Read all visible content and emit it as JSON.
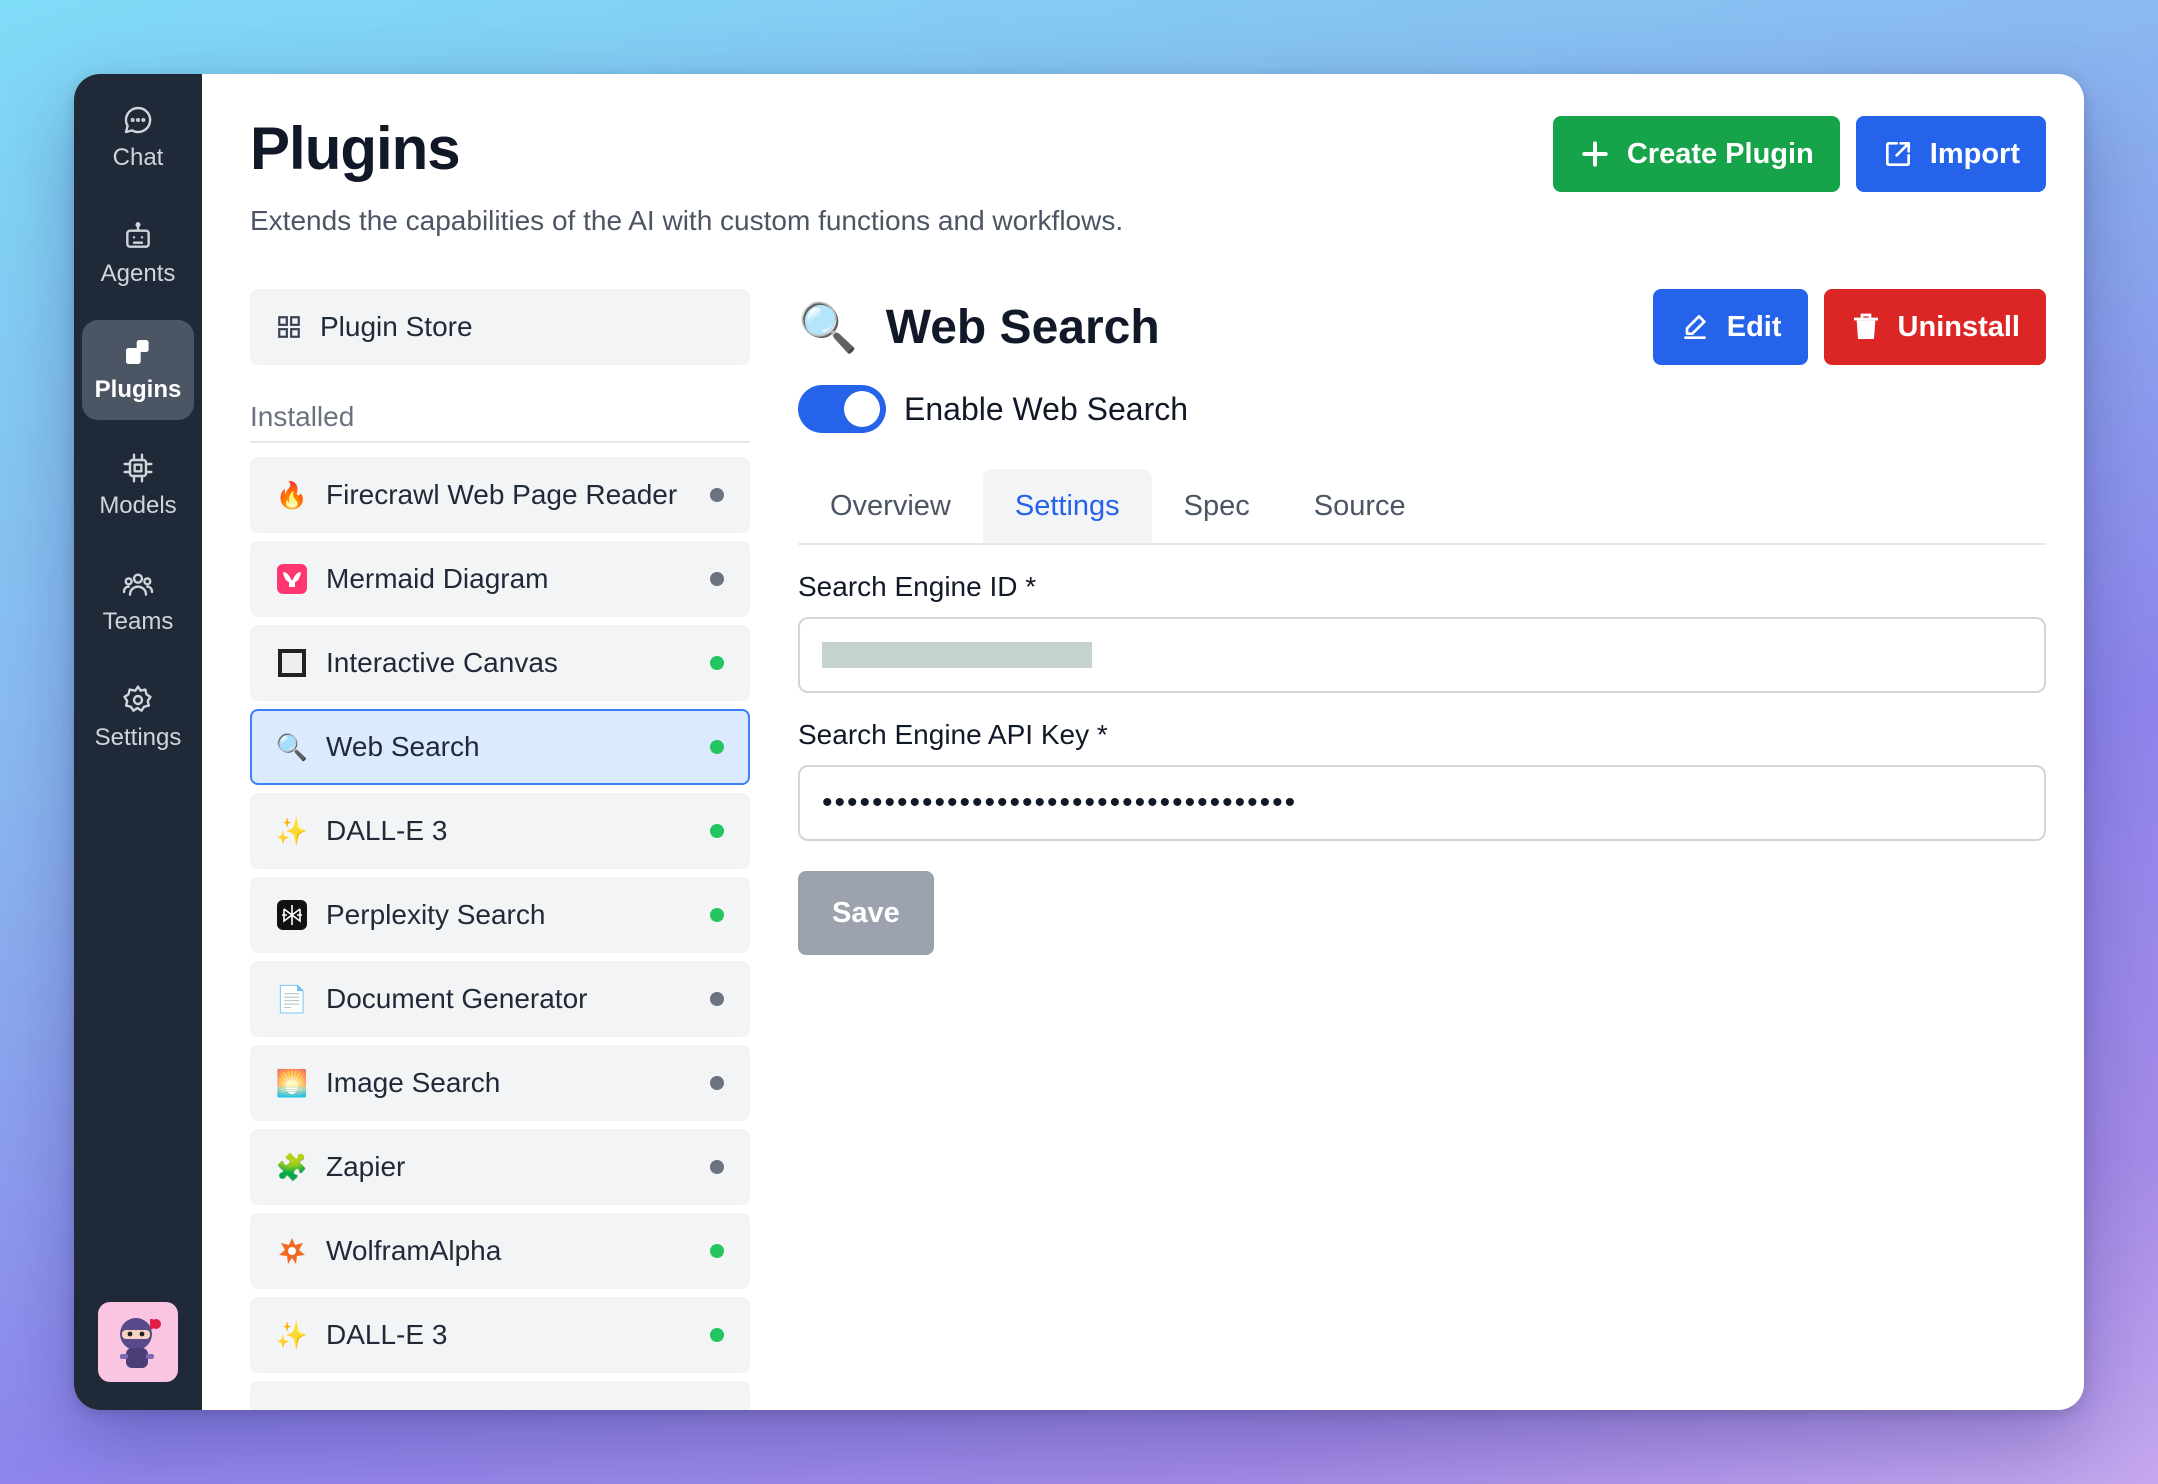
{
  "sidebar": {
    "items": [
      {
        "label": "Chat",
        "icon": "chat-icon"
      },
      {
        "label": "Agents",
        "icon": "agents-icon"
      },
      {
        "label": "Plugins",
        "icon": "plugins-icon",
        "active": true
      },
      {
        "label": "Models",
        "icon": "models-icon"
      },
      {
        "label": "Teams",
        "icon": "teams-icon"
      },
      {
        "label": "Settings",
        "icon": "settings-icon"
      }
    ]
  },
  "header": {
    "title": "Plugins",
    "subtitle": "Extends the capabilities of the AI with custom functions and workflows.",
    "create_label": "Create Plugin",
    "import_label": "Import"
  },
  "store": {
    "label": "Plugin Store"
  },
  "installed": {
    "label": "Installed",
    "items": [
      {
        "name": "Firecrawl Web Page Reader",
        "icon": "🔥",
        "enabled": false
      },
      {
        "name": "Mermaid Diagram",
        "icon": "mermaid",
        "enabled": false
      },
      {
        "name": "Interactive Canvas",
        "icon": "canvas",
        "enabled": true
      },
      {
        "name": "Web Search",
        "icon": "🔍",
        "enabled": true,
        "selected": true
      },
      {
        "name": "DALL-E 3",
        "icon": "✨",
        "enabled": true
      },
      {
        "name": "Perplexity Search",
        "icon": "perplexity",
        "enabled": true
      },
      {
        "name": "Document Generator",
        "icon": "📄",
        "enabled": false
      },
      {
        "name": "Image Search",
        "icon": "🌅",
        "enabled": false
      },
      {
        "name": "Zapier",
        "icon": "🧩",
        "enabled": false
      },
      {
        "name": "WolframAlpha",
        "icon": "wolfram",
        "enabled": true
      },
      {
        "name": "DALL-E 3",
        "icon": "✨",
        "enabled": true
      }
    ]
  },
  "detail": {
    "icon": "🔍",
    "title": "Web Search",
    "edit_label": "Edit",
    "uninstall_label": "Uninstall",
    "toggle_label": "Enable Web Search",
    "toggle_on": true,
    "tabs": [
      "Overview",
      "Settings",
      "Spec",
      "Source"
    ],
    "active_tab": "Settings",
    "fields": {
      "engine_id_label": "Search Engine ID *",
      "api_key_label": "Search Engine API Key *",
      "api_key_value": "••••••••••••••••••••••••••••••••••••••"
    },
    "save_label": "Save"
  },
  "colors": {
    "accent": "#2563eb",
    "success": "#16a34a",
    "danger": "#dc2626",
    "sidebar_bg": "#1f2937"
  }
}
